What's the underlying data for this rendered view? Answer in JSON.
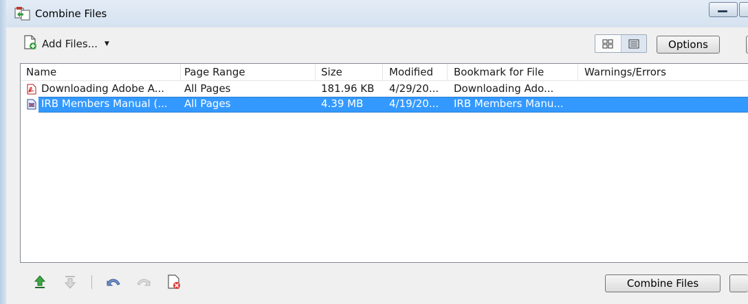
{
  "window": {
    "title": "Combine Files",
    "icon": "combine-files-icon"
  },
  "toolbar": {
    "add_files_label": "Add Files...",
    "add_files_icon": "add-file-icon",
    "view_thumbnails_icon": "thumbnail-view-icon",
    "view_list_icon": "list-view-icon",
    "options_label": "Options"
  },
  "table": {
    "columns": [
      "Name",
      "Page Range",
      "Size",
      "Modified",
      "Bookmark for File",
      "Warnings/Errors"
    ],
    "rows": [
      {
        "name": "Downloading Adobe A...",
        "page_range": "All Pages",
        "size": "181.96 KB",
        "modified": "4/29/20...",
        "bookmark": "Downloading Ado...",
        "warnings": "",
        "icon": "pdf-file-icon",
        "selected": false
      },
      {
        "name": "IRB Members Manual (...",
        "page_range": "All Pages",
        "size": "4.39 MB",
        "modified": "4/19/20...",
        "bookmark": "IRB Members Manu...",
        "warnings": "",
        "icon": "document-file-icon",
        "selected": true
      }
    ]
  },
  "bottom_toolbar": {
    "move_up_icon": "move-up-icon",
    "move_down_icon": "move-down-icon",
    "undo_icon": "undo-icon",
    "redo_icon": "redo-icon",
    "remove_icon": "remove-file-icon",
    "combine_label": "Combine Files"
  },
  "colors": {
    "selection": "#3399ff",
    "titlebar": "#d5e2f0"
  }
}
